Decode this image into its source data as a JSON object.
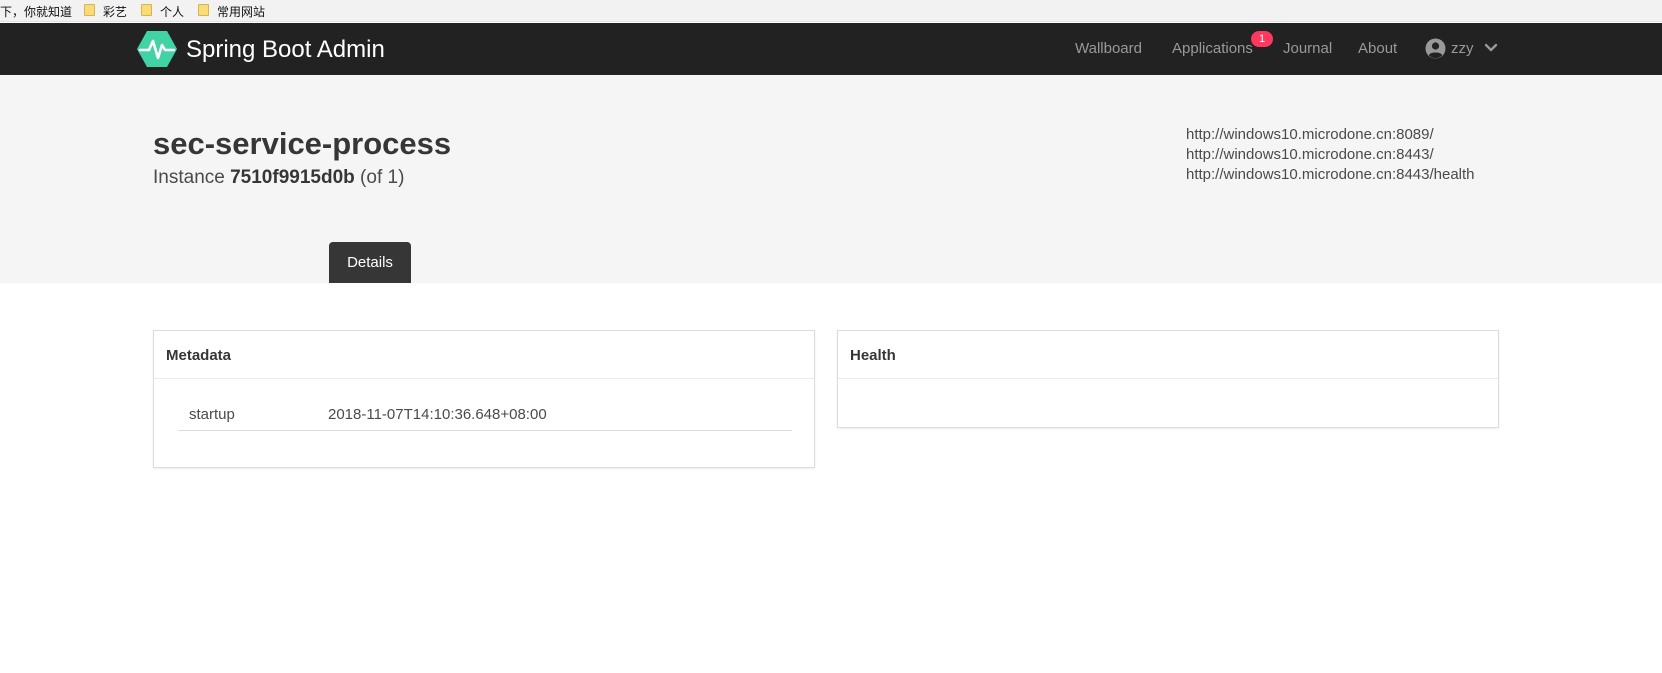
{
  "bookmarks": [
    {
      "label": "下，你就知道"
    },
    {
      "label": "彩艺"
    },
    {
      "label": "个人"
    },
    {
      "label": "常用网站"
    }
  ],
  "navbar": {
    "brand": "Spring Boot Admin",
    "links": {
      "wallboard": "Wallboard",
      "applications": "Applications",
      "journal": "Journal",
      "about": "About"
    },
    "applications_badge": "1",
    "user": "zzy"
  },
  "instance": {
    "app_name": "sec-service-process",
    "prefix": "Instance",
    "id": "7510f9915d0b",
    "count_text": "(of 1)",
    "urls": [
      "http://windows10.microdone.cn:8089/",
      "http://windows10.microdone.cn:8443/",
      "http://windows10.microdone.cn:8443/health"
    ]
  },
  "tabs": {
    "details": "Details"
  },
  "metadata": {
    "title": "Metadata",
    "rows": [
      {
        "key": "startup",
        "value": "2018-11-07T14:10:36.648+08:00"
      }
    ]
  },
  "health": {
    "title": "Health"
  },
  "colors": {
    "navbar_bg": "#222222",
    "brand_logo": "#42d3a5",
    "badge": "#ff3860",
    "tab_active_bg": "#363636",
    "hero_bg": "#f5f5f5"
  }
}
